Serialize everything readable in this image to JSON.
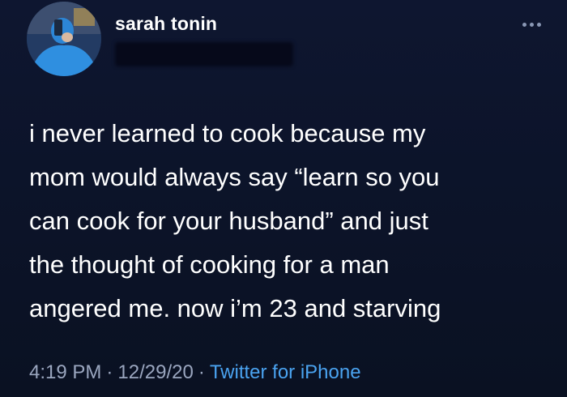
{
  "author": {
    "display_name": "sarah tonin"
  },
  "more_icon": "more-horizontal-icon",
  "tweet": {
    "lines": [
      "i never learned to cook because my",
      "mom would always say “learn so you",
      "can cook for your husband” and just",
      "the thought of cooking for a man",
      "angered me. now i’m 23 and starving"
    ]
  },
  "meta": {
    "time": "4:19 PM",
    "separator": "·",
    "date": "12/29/20",
    "source": "Twitter for iPhone"
  },
  "colors": {
    "background": "#0b1224",
    "text": "#ffffff",
    "muted": "#9aa6bf",
    "link": "#4aa3f0"
  }
}
